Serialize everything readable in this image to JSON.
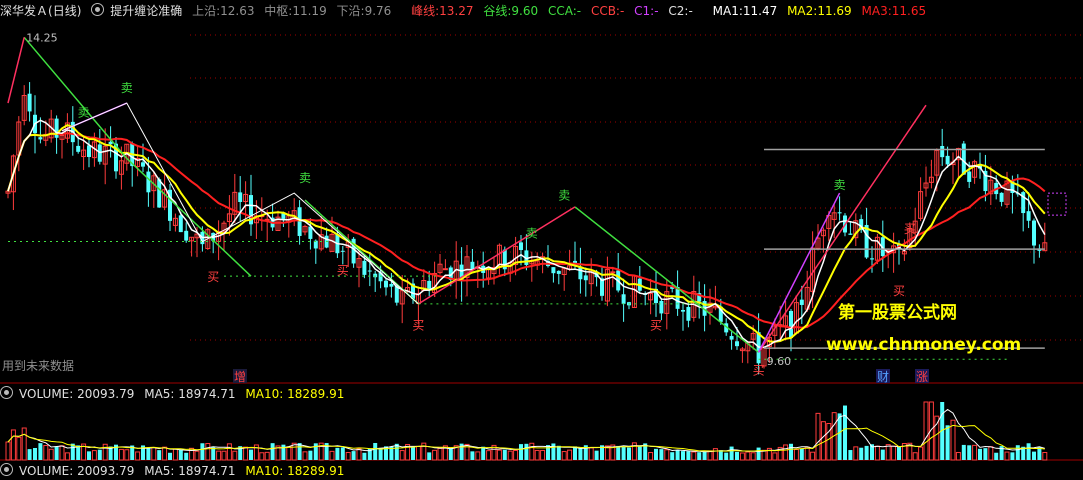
{
  "header": {
    "stock_name": "深华发Ａ",
    "period": "(日线)",
    "indicator": "提升缠论准确",
    "upper_label": "上沿:",
    "upper_value": "12.63",
    "mid_label": "中枢:",
    "mid_value": "11.19",
    "lower_label": "下沿:",
    "lower_value": "9.76",
    "peak_label": "峰线:",
    "peak_value": "13.27",
    "valley_label": "谷线:",
    "valley_value": "9.60",
    "cca_label": "CCA:",
    "cca_value": "-",
    "ccb_label": "CCB:",
    "ccb_value": "-",
    "c1_label": "C1:",
    "c1_value": "-",
    "c2_label": "C2:",
    "c2_value": "-",
    "ma1_label": "MA1:",
    "ma1_value": "11.47",
    "ma2_label": "MA2:",
    "ma2_value": "11.69",
    "ma3_label": "MA3:",
    "ma3_value": "11.65"
  },
  "volume_header": {
    "volume_label": "VOLUME:",
    "volume_value": "20093.79",
    "ma5_label": "MA5:",
    "ma5_value": "18974.71",
    "ma10_label": "MA10:",
    "ma10_value": "18289.91"
  },
  "volume_header_dup": {
    "volume_label": "VOLUME:",
    "volume_value": "20093.79",
    "ma5_label": "MA5:",
    "ma5_value": "18974.71",
    "ma10_label": "MA10:",
    "ma10_value": "18289.91"
  },
  "labels": {
    "high_price": "14.25",
    "low_price": "9.60",
    "future_data": "用到未来数据",
    "increase_marker": "增",
    "finance_marker": "财",
    "rise_marker": "涨",
    "sell": "卖",
    "buy": "买"
  },
  "watermark": {
    "line1": "第一股票公式网",
    "line2": "www.chnmoney.com"
  },
  "colors": {
    "up": "#ff3c3c",
    "down": "#54ffff",
    "ma1": "#ffffff",
    "ma2": "#ffff00",
    "ma3": "#ff2020",
    "zigzag_down": "#40e040",
    "zigzag_up": "#ff3060",
    "zigzag_fine": "#d040ff",
    "pivot_line": "#a0a0a0",
    "green_text": "#40e040",
    "red_text": "#ff4040",
    "watermark_yellow": "#ffff00"
  },
  "chart_data": {
    "type": "candlestick",
    "price_range": [
      9.3,
      14.5
    ],
    "peak_price": 13.27,
    "valley_price": 9.6,
    "ohlc_sampled": [
      {
        "i": 0,
        "o": 12.1,
        "h": 12.5,
        "l": 11.9,
        "c": 12.3
      },
      {
        "i": 3,
        "o": 13.6,
        "h": 14.25,
        "l": 12.8,
        "c": 13.0
      },
      {
        "i": 10,
        "o": 12.5,
        "h": 13.5,
        "l": 12.4,
        "c": 13.3
      },
      {
        "i": 22,
        "o": 13.0,
        "h": 13.4,
        "l": 12.3,
        "c": 12.5
      },
      {
        "i": 36,
        "o": 11.9,
        "h": 12.1,
        "l": 11.0,
        "c": 11.2
      },
      {
        "i": 51,
        "o": 11.8,
        "h": 12.0,
        "l": 11.3,
        "c": 11.5
      },
      {
        "i": 73,
        "o": 10.9,
        "h": 11.2,
        "l": 10.3,
        "c": 10.4
      },
      {
        "i": 95,
        "o": 10.8,
        "h": 11.5,
        "l": 10.7,
        "c": 11.0
      },
      {
        "i": 120,
        "o": 10.6,
        "h": 10.8,
        "l": 10.2,
        "c": 10.4
      },
      {
        "i": 139,
        "o": 9.8,
        "h": 10.0,
        "l": 9.6,
        "c": 9.7
      },
      {
        "i": 152,
        "o": 11.5,
        "h": 12.1,
        "l": 11.4,
        "c": 12.0
      },
      {
        "i": 172,
        "o": 12.3,
        "h": 13.27,
        "l": 12.1,
        "c": 12.6
      },
      {
        "i": 192,
        "o": 11.9,
        "h": 12.2,
        "l": 11.0,
        "c": 11.1
      }
    ],
    "volume_latest": 20093.79,
    "volume_ma5": 18974.71,
    "volume_ma10": 18289.91
  }
}
